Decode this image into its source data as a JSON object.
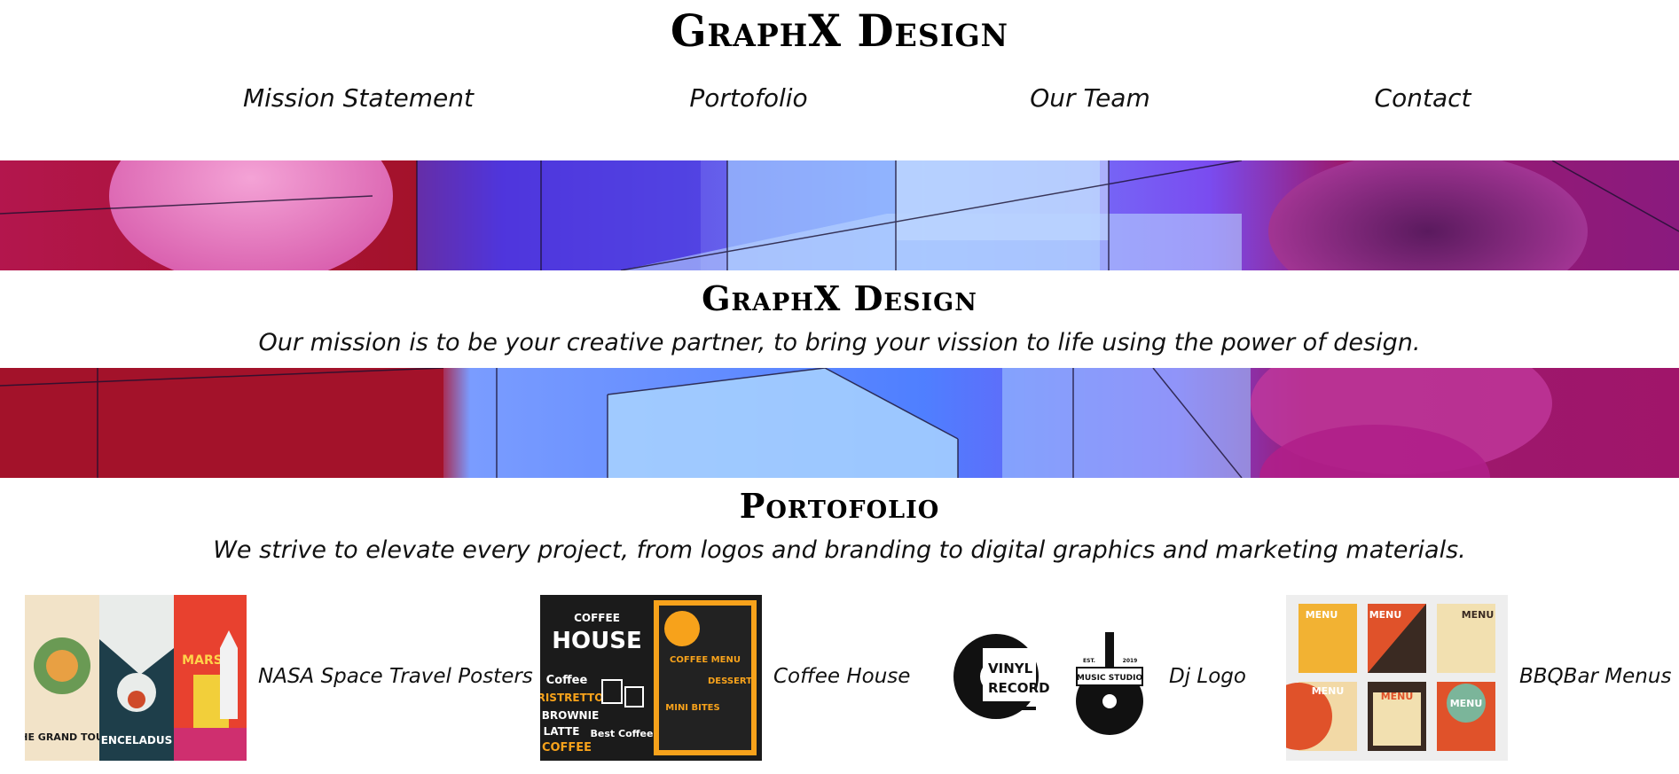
{
  "brand": {
    "name": "GraphX Design"
  },
  "nav": {
    "items": [
      "Mission Statement",
      "Portofolio",
      "Our Team",
      "Contact"
    ]
  },
  "mission": {
    "title": "GraphX Design",
    "text": "Our mission is to be your creative partner, to bring your vission to life using the power of design."
  },
  "portfolio": {
    "title": "Portofolio",
    "text": "We strive to elevate every project, from logos and branding to digital graphics and marketing materials.",
    "items": [
      {
        "label": "NASA Space Travel Posters",
        "image_text": [
          "THE GRAND TOUR",
          "ENCELADUS",
          "MARS"
        ]
      },
      {
        "label": "Coffee House",
        "image_text": [
          "COFFEE",
          "HOUSE",
          "COFFEE MENU",
          "Coffee",
          "RISTRETTO",
          "BROWNIE",
          "LATTE",
          "COFFEE",
          "DESSERT",
          "MINI BITES",
          "Best Coffee"
        ]
      },
      {
        "label": "Dj Logo",
        "image_text": [
          "VINYL",
          "RECORD",
          "MUSIC STUDIO",
          "EST.",
          "2019"
        ]
      },
      {
        "label": "BBQBar Menus",
        "image_text": [
          "MENU",
          "MENU",
          "MENU",
          "MENU",
          "MENU",
          "MENU"
        ]
      }
    ]
  },
  "colors": {
    "banner_magenta": "#9b1a6e",
    "banner_red": "#a3122a",
    "banner_blue": "#5a7dff",
    "banner_violet": "#5a1a9e",
    "bbq_orange": "#e0522a",
    "bbq_yellow": "#f2b233",
    "coffee_orange": "#f7a21b",
    "poster_red": "#e8412f"
  }
}
